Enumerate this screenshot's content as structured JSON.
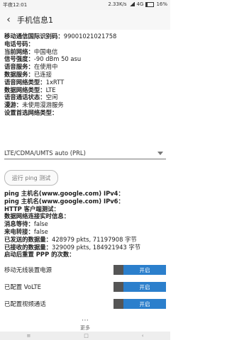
{
  "status": {
    "time": "半夜12:01",
    "network_speed": "2.33K/s",
    "network_type": "4G",
    "battery": "16%"
  },
  "header": {
    "title": "手机信息1"
  },
  "info": [
    {
      "label": "移动通信国际识别码：",
      "value": "99001021021758"
    },
    {
      "label": "电话号码：",
      "value": ""
    },
    {
      "label": "当前网络：",
      "value": "中国电信"
    },
    {
      "label": "信号强度：",
      "value": "-90 dBm   50 asu"
    },
    {
      "label": "语音服务：",
      "value": "在使用中"
    },
    {
      "label": "数据服务：",
      "value": "已连接"
    },
    {
      "label": "语音网络类型：",
      "value": "1xRTT"
    },
    {
      "label": "数据网络类型：",
      "value": "LTE"
    },
    {
      "label": "语音通话状态：",
      "value": "空闲"
    },
    {
      "label": "漫游：",
      "value": "未使用漫游服务"
    },
    {
      "label": "设置首选网络类型：",
      "value": ""
    }
  ],
  "preferred_network": "LTE/CDMA/UMTS auto (PRL)",
  "ping_button": "运行 ping 测试",
  "ping": [
    {
      "label": "ping 主机名(www.google.com) IPv4：",
      "value": ""
    },
    {
      "label": "ping 主机名(www.google.com) IPv6：",
      "value": ""
    },
    {
      "label": "HTTP 客户端测试：",
      "value": ""
    },
    {
      "label": "数据网络连接实时信息：",
      "value": ""
    },
    {
      "label": "消息等待：",
      "value": "false"
    },
    {
      "label": "来电转接：",
      "value": "false"
    },
    {
      "label": "已发送的数据量：",
      "value": "428979 pkts, 71197908 字节"
    },
    {
      "label": "已接收的数据量：",
      "value": "329009 pkts, 184921943 字节"
    },
    {
      "label": "启动后重置 PPP 的次数：",
      "value": ""
    }
  ],
  "toggles": [
    {
      "label": "移动无线装置电源",
      "button": "开启"
    },
    {
      "label": "已配置 VoLTE",
      "button": "开启"
    },
    {
      "label": "已配置视频通话",
      "button": "开启"
    }
  ],
  "more_label": "更多"
}
